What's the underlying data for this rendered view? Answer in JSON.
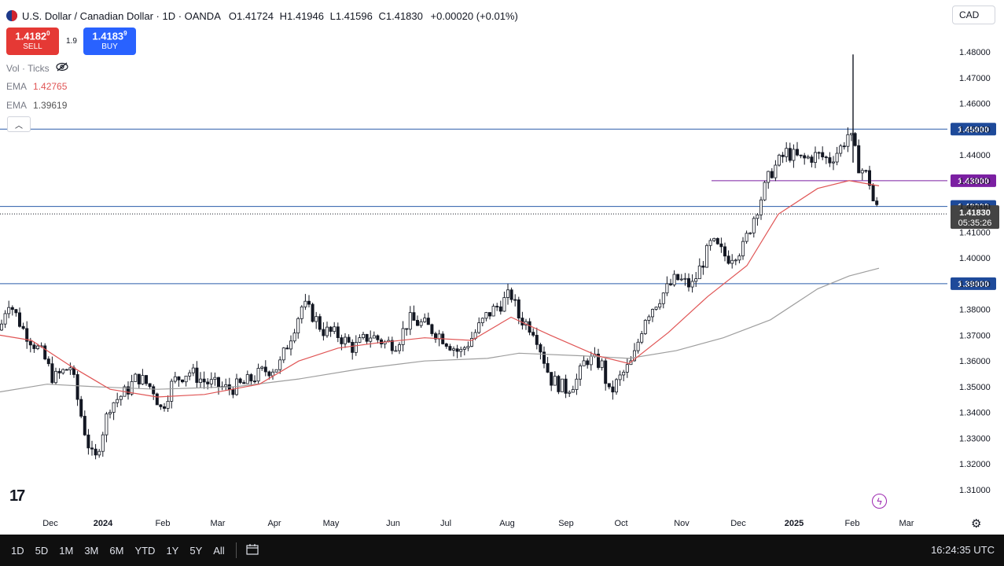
{
  "header": {
    "title": "U.S. Dollar / Canadian Dollar · 1D · OANDA",
    "open_label": "O",
    "open": "1.41724",
    "high_label": "H",
    "high": "1.41946",
    "low_label": "L",
    "low": "1.41596",
    "close_label": "C",
    "close": "1.41830",
    "change": "+0.00020 (+0.01%)"
  },
  "currency_selector": "CAD",
  "trade": {
    "sell_price_main": "1.4182",
    "sell_price_sup": "0",
    "sell_label": "SELL",
    "spread": "1.9",
    "buy_price_main": "1.4183",
    "buy_price_sup": "9",
    "buy_label": "BUY"
  },
  "legend": {
    "vol_label": "Vol · Ticks",
    "ema1_label": "EMA",
    "ema1_value": "1.42765",
    "ema2_label": "EMA",
    "ema2_value": "1.39619"
  },
  "colors": {
    "up": "#131722",
    "down": "#131722",
    "ema_fast": "#e05555",
    "ema_slow": "#a0a0a0",
    "level_blue": "#2a5caa",
    "level_purple": "#7b1fa2"
  },
  "chart_data": {
    "type": "candlestick",
    "title": "U.S. Dollar / Canadian Dollar · 1D · OANDA",
    "ylim": [
      1.305,
      1.487
    ],
    "y_ticks": [
      "1.48000",
      "1.47000",
      "1.46000",
      "1.45000",
      "1.44000",
      "1.43000",
      "1.42000",
      "1.41000",
      "1.40000",
      "1.39000",
      "1.38000",
      "1.37000",
      "1.36000",
      "1.35000",
      "1.34000",
      "1.33000",
      "1.32000",
      "1.31000"
    ],
    "x_ticks": [
      "Dec",
      "2024",
      "Feb",
      "Mar",
      "Apr",
      "May",
      "Jun",
      "Jul",
      "Aug",
      "Sep",
      "Oct",
      "Nov",
      "Dec",
      "2025",
      "Feb",
      "Mar"
    ],
    "price_tag": {
      "value": "1.41830",
      "countdown": "05:35:26"
    },
    "levels": [
      {
        "value": 1.45,
        "label": "1.45000",
        "color": "blue"
      },
      {
        "value": 1.43,
        "label": "1.43000",
        "color": "purple"
      },
      {
        "value": 1.42,
        "label": "1.42000",
        "color": "blue"
      },
      {
        "value": 1.39,
        "label": "1.39000",
        "color": "blue"
      }
    ],
    "close_series_monthly": [
      {
        "month": "2023-11",
        "close": 1.372
      },
      {
        "month": "2023-12",
        "close": 1.325
      },
      {
        "month": "2024-01",
        "close": 1.343
      },
      {
        "month": "2024-02",
        "close": 1.357
      },
      {
        "month": "2024-03",
        "close": 1.355
      },
      {
        "month": "2024-04",
        "close": 1.383
      },
      {
        "month": "2024-05",
        "close": 1.371
      },
      {
        "month": "2024-06",
        "close": 1.369
      },
      {
        "month": "2024-07",
        "close": 1.362
      },
      {
        "month": "2024-08",
        "close": 1.382
      },
      {
        "month": "2024-09",
        "close": 1.347
      },
      {
        "month": "2024-10",
        "close": 1.353
      },
      {
        "month": "2024-11",
        "close": 1.393
      },
      {
        "month": "2024-12",
        "close": 1.437
      },
      {
        "month": "2025-01",
        "close": 1.434
      },
      {
        "month": "2025-02",
        "close": 1.4183
      }
    ],
    "anchors": [
      [
        0,
        1.372
      ],
      [
        10,
        1.384
      ],
      [
        30,
        1.372
      ],
      [
        55,
        1.362
      ],
      [
        68,
        1.353
      ],
      [
        90,
        1.358
      ],
      [
        100,
        1.343
      ],
      [
        110,
        1.33
      ],
      [
        120,
        1.32
      ],
      [
        128,
        1.33
      ],
      [
        140,
        1.343
      ],
      [
        160,
        1.348
      ],
      [
        175,
        1.354
      ],
      [
        195,
        1.349
      ],
      [
        205,
        1.341
      ],
      [
        220,
        1.352
      ],
      [
        240,
        1.356
      ],
      [
        260,
        1.352
      ],
      [
        290,
        1.349
      ],
      [
        310,
        1.351
      ],
      [
        335,
        1.356
      ],
      [
        355,
        1.358
      ],
      [
        370,
        1.37
      ],
      [
        385,
        1.382
      ],
      [
        400,
        1.377
      ],
      [
        410,
        1.372
      ],
      [
        430,
        1.37
      ],
      [
        450,
        1.365
      ],
      [
        470,
        1.37
      ],
      [
        490,
        1.367
      ],
      [
        505,
        1.367
      ],
      [
        520,
        1.376
      ],
      [
        540,
        1.374
      ],
      [
        560,
        1.37
      ],
      [
        585,
        1.363
      ],
      [
        600,
        1.369
      ],
      [
        620,
        1.378
      ],
      [
        640,
        1.383
      ],
      [
        650,
        1.386
      ],
      [
        660,
        1.377
      ],
      [
        680,
        1.372
      ],
      [
        700,
        1.353
      ],
      [
        720,
        1.349
      ],
      [
        735,
        1.353
      ],
      [
        745,
        1.361
      ],
      [
        765,
        1.359
      ],
      [
        775,
        1.347
      ],
      [
        790,
        1.354
      ],
      [
        805,
        1.36
      ],
      [
        820,
        1.377
      ],
      [
        840,
        1.385
      ],
      [
        860,
        1.392
      ],
      [
        880,
        1.389
      ],
      [
        905,
        1.406
      ],
      [
        925,
        1.4
      ],
      [
        945,
        1.404
      ],
      [
        960,
        1.417
      ],
      [
        980,
        1.433
      ],
      [
        1000,
        1.441
      ],
      [
        1020,
        1.438
      ],
      [
        1040,
        1.44
      ],
      [
        1055,
        1.438
      ],
      [
        1070,
        1.443
      ],
      [
        1080,
        1.449
      ],
      [
        1092,
        1.436
      ],
      [
        1105,
        1.431
      ],
      [
        1112,
        1.42
      ],
      [
        1118,
        1.4183
      ]
    ],
    "ema_fast_points": [
      [
        0,
        1.37
      ],
      [
        40,
        1.368
      ],
      [
        90,
        1.358
      ],
      [
        140,
        1.349
      ],
      [
        200,
        1.346
      ],
      [
        260,
        1.347
      ],
      [
        330,
        1.351
      ],
      [
        380,
        1.36
      ],
      [
        430,
        1.365
      ],
      [
        480,
        1.367
      ],
      [
        540,
        1.369
      ],
      [
        600,
        1.368
      ],
      [
        650,
        1.377
      ],
      [
        700,
        1.37
      ],
      [
        760,
        1.362
      ],
      [
        800,
        1.359
      ],
      [
        850,
        1.371
      ],
      [
        900,
        1.385
      ],
      [
        950,
        1.397
      ],
      [
        990,
        1.417
      ],
      [
        1040,
        1.427
      ],
      [
        1080,
        1.43
      ],
      [
        1118,
        1.428
      ]
    ],
    "ema_slow_points": [
      [
        0,
        1.348
      ],
      [
        60,
        1.351
      ],
      [
        120,
        1.35
      ],
      [
        200,
        1.349
      ],
      [
        300,
        1.35
      ],
      [
        380,
        1.353
      ],
      [
        460,
        1.357
      ],
      [
        540,
        1.36
      ],
      [
        620,
        1.361
      ],
      [
        660,
        1.363
      ],
      [
        740,
        1.362
      ],
      [
        800,
        1.361
      ],
      [
        860,
        1.364
      ],
      [
        920,
        1.369
      ],
      [
        980,
        1.376
      ],
      [
        1040,
        1.388
      ],
      [
        1080,
        1.393
      ],
      [
        1118,
        1.396
      ]
    ]
  },
  "timeframes": [
    "1D",
    "5D",
    "1M",
    "3M",
    "6M",
    "YTD",
    "1Y",
    "5Y",
    "All"
  ],
  "toolbar_icons": {
    "calendar": "calendar-range-icon"
  },
  "clock": "16:24:35 UTC"
}
